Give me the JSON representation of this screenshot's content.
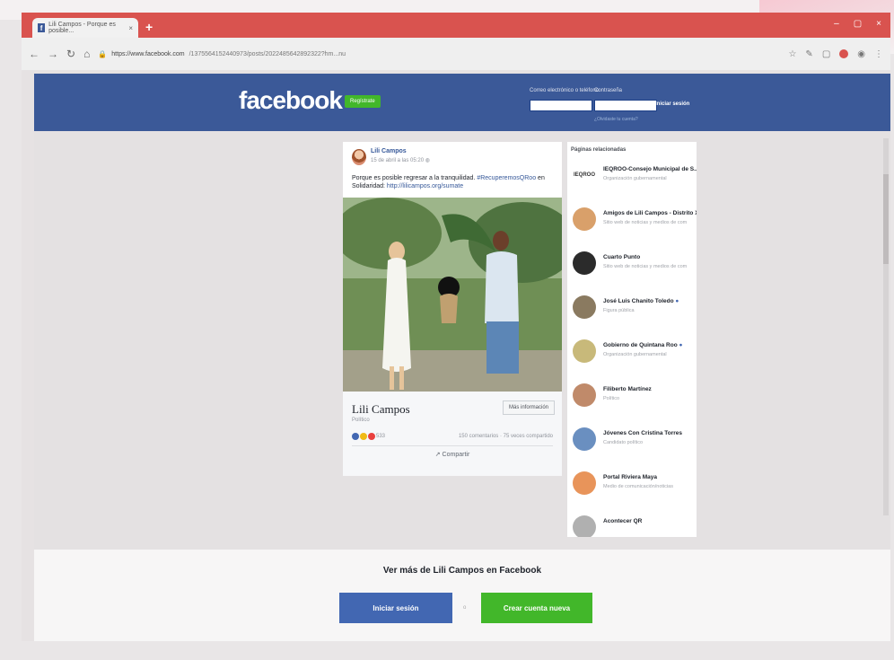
{
  "browser": {
    "tab_title": "Lili Campos - Porque es posible...",
    "tab_close": "×",
    "new_tab": "+",
    "window_controls": [
      "–",
      "▢",
      "×"
    ],
    "url_host": "https://www.facebook.com",
    "url_path": "/1375564152440973/posts/2022485642892322?hm...nu"
  },
  "fb_header": {
    "logo": "facebook",
    "signup": "Regístrate",
    "email_label": "Correo electrónico o teléfono",
    "password_label": "Contraseña",
    "login_button": "Iniciar sesión",
    "forgot": "¿Olvidaste tu cuenta?"
  },
  "post": {
    "author": "Lili Campos",
    "date": "15 de abril a las 05:20",
    "text": "Porque es posible regresar a la tranquilidad.",
    "hashtag": "#RecuperemosQRoo",
    "text_suffix": "en Solidaridad:",
    "link": "http://lilicampos.org/sumate",
    "page_name": "Lili Campos",
    "page_category": "Político",
    "more_info_button": "Más información",
    "reaction_count": "533",
    "stats": "150 comentarios · 75 veces compartido",
    "share_button": "Compartir"
  },
  "related": {
    "heading": "Páginas relacionadas",
    "items": [
      {
        "name": "IEQROO-Consejo Municipal de S...",
        "sub": "Organización gubernamental",
        "color": "#ffffff",
        "badge": "IEQROO"
      },
      {
        "name": "Amigos de Lili Campos - Distrito X",
        "sub": "Sitio web de noticias y medios de com",
        "color": "#d9a06a"
      },
      {
        "name": "Cuarto Punto",
        "sub": "Sitio web de noticias y medios de com",
        "color": "#2b2b2b"
      },
      {
        "name": "José Luis Chanito Toledo",
        "sub": "Figura pública",
        "color": "#8a7a60",
        "verified": "●"
      },
      {
        "name": "Gobierno de Quintana Roo",
        "sub": "Organización gubernamental",
        "color": "#c8b97a",
        "verified": "●"
      },
      {
        "name": "Filiberto Martínez",
        "sub": "Político",
        "color": "#c08a6a"
      },
      {
        "name": "Jóvenes Con Cristina Torres",
        "sub": "Candidato político",
        "color": "#6a8fc0"
      },
      {
        "name": "Portal Riviera Maya",
        "sub": "Medio de comunicación/noticias",
        "color": "#e8945a"
      },
      {
        "name": "Acontecer QR",
        "sub": "",
        "color": "#b0b0b0"
      }
    ]
  },
  "bottom": {
    "title": "Ver más de Lili Campos en Facebook",
    "login": "Iniciar sesión",
    "or": "o",
    "create": "Crear cuenta nueva"
  },
  "colors": {
    "fb_blue": "#3b5998",
    "green": "#42b72a",
    "tab_red": "#d9534f"
  }
}
